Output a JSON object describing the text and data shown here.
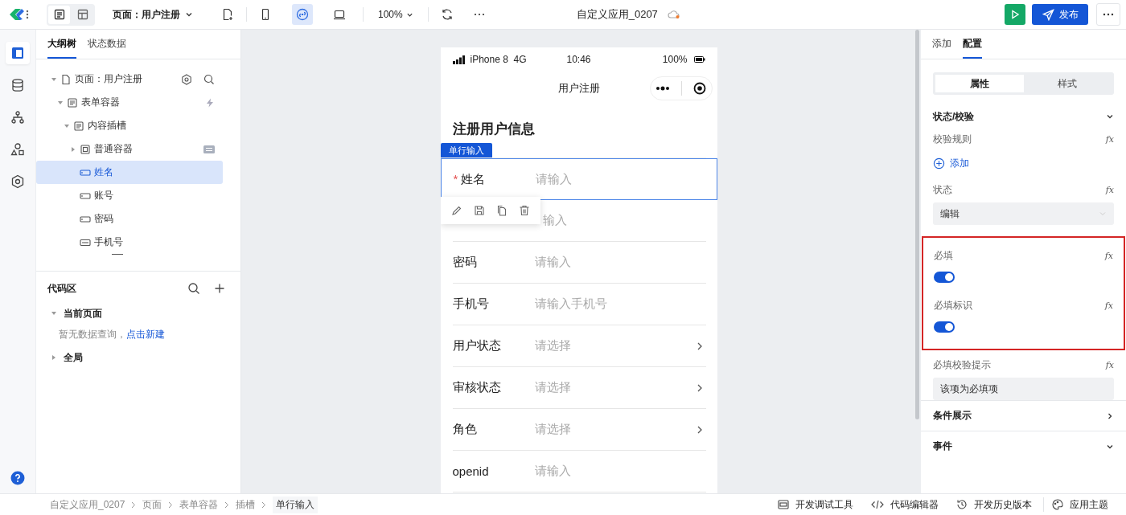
{
  "toolbar": {
    "view_modes": [
      {
        "kind": "page",
        "selected": true
      },
      {
        "kind": "layout",
        "selected": false
      }
    ],
    "page_selector": "页面：用户注册",
    "devices": [
      {
        "kind": "phone",
        "selected": false
      },
      {
        "kind": "miniprogram",
        "selected": true
      },
      {
        "kind": "desktop",
        "selected": false
      }
    ],
    "zoom": "100%",
    "app_title": "自定义应用_0207",
    "publish": "发布"
  },
  "rail": [
    {
      "kind": "outline",
      "selected": true
    },
    {
      "kind": "data",
      "selected": false
    },
    {
      "kind": "flow",
      "selected": false
    },
    {
      "kind": "components",
      "selected": false
    },
    {
      "kind": "settings",
      "selected": false
    }
  ],
  "left_tabs": [
    {
      "label": "大纲树",
      "selected": true
    },
    {
      "label": "状态数据",
      "selected": false
    }
  ],
  "tree": [
    {
      "label": "页面：用户注册",
      "kind": "page",
      "expanded": true,
      "selected": false,
      "children": [
        {
          "label": "表单容器",
          "kind": "form",
          "expanded": true,
          "selected": false,
          "children": [
            {
              "label": "内容插槽",
              "kind": "form",
              "expanded": true,
              "selected": false,
              "children": [
                {
                  "label": "普通容器",
                  "kind": "container",
                  "expanded": false,
                  "selected": false
                },
                {
                  "label": "姓名",
                  "kind": "input",
                  "selected": true
                },
                {
                  "label": "账号",
                  "kind": "input",
                  "selected": false
                },
                {
                  "label": "密码",
                  "kind": "input",
                  "selected": false
                },
                {
                  "label": "手机号",
                  "kind": "phone",
                  "selected": false
                }
              ]
            }
          ]
        }
      ]
    }
  ],
  "code_area": {
    "title": "代码区",
    "groups": [
      {
        "label": "当前页面",
        "expanded": true,
        "empty_text": "暂无数据查询，",
        "link": "点击新建"
      },
      {
        "label": "全局",
        "expanded": false
      }
    ]
  },
  "phone": {
    "required_mark": "*",
    "carrier": "iPhone 8  4G",
    "time": "10:46",
    "battery": "100%",
    "title": "用户注册",
    "section_title": "注册用户信息",
    "selected_tag": "单行输入",
    "rows": [
      {
        "kind": "input",
        "label": "姓名",
        "required": true,
        "placeholder": "请输入",
        "selected": true
      },
      {
        "kind": "input",
        "placeholder": "输入",
        "selected": false
      },
      {
        "kind": "input",
        "label": "密码",
        "required": false,
        "placeholder": "请输入",
        "selected": false
      },
      {
        "kind": "input",
        "label": "手机号",
        "required": false,
        "placeholder": "请输入手机号",
        "selected": false
      },
      {
        "kind": "select",
        "label": "用户状态",
        "required": false,
        "placeholder": "请选择",
        "selected": false
      },
      {
        "kind": "select",
        "label": "审核状态",
        "required": false,
        "placeholder": "请选择",
        "selected": false
      },
      {
        "kind": "select",
        "label": "角色",
        "required": false,
        "placeholder": "请选择",
        "selected": false
      },
      {
        "kind": "input",
        "label": "openid",
        "required": false,
        "placeholder": "请输入",
        "selected": false
      }
    ]
  },
  "right_tabs": [
    {
      "label": "添加",
      "selected": false
    },
    {
      "label": "配置",
      "selected": true
    }
  ],
  "segments": [
    {
      "label": "属性",
      "selected": true
    },
    {
      "label": "样式",
      "selected": false
    }
  ],
  "section": {
    "title": "状态/校验",
    "expanded": true
  },
  "props": [
    {
      "kind": "rules",
      "label": "校验规则",
      "formula": "fx",
      "add": "添加"
    },
    {
      "kind": "select",
      "label": "状态",
      "formula": "fx",
      "value": "编辑"
    },
    {
      "kind": "group",
      "highlighted": true,
      "items": [
        {
          "kind": "switch",
          "label": "必填",
          "formula": "fx",
          "on": true
        },
        {
          "kind": "switch",
          "label": "必填标识",
          "formula": "fx",
          "on": true
        }
      ]
    },
    {
      "kind": "text",
      "label": "必填校验提示",
      "formula": "fx",
      "value": "该项为必填项"
    }
  ],
  "more_sections": [
    {
      "title": "条件展示",
      "expanded": false
    },
    {
      "title": "事件",
      "expanded": true
    }
  ],
  "breadcrumb": [
    "自定义应用_0207",
    "页面",
    "表单容器",
    "插槽",
    "单行输入"
  ],
  "footer_tools": [
    {
      "kind": "debug",
      "label": "开发调试工具"
    },
    {
      "kind": "code",
      "label": "代码编辑器"
    },
    {
      "kind": "history",
      "label": "开发历史版本"
    },
    {
      "kind": "theme",
      "label": "应用主题"
    }
  ]
}
